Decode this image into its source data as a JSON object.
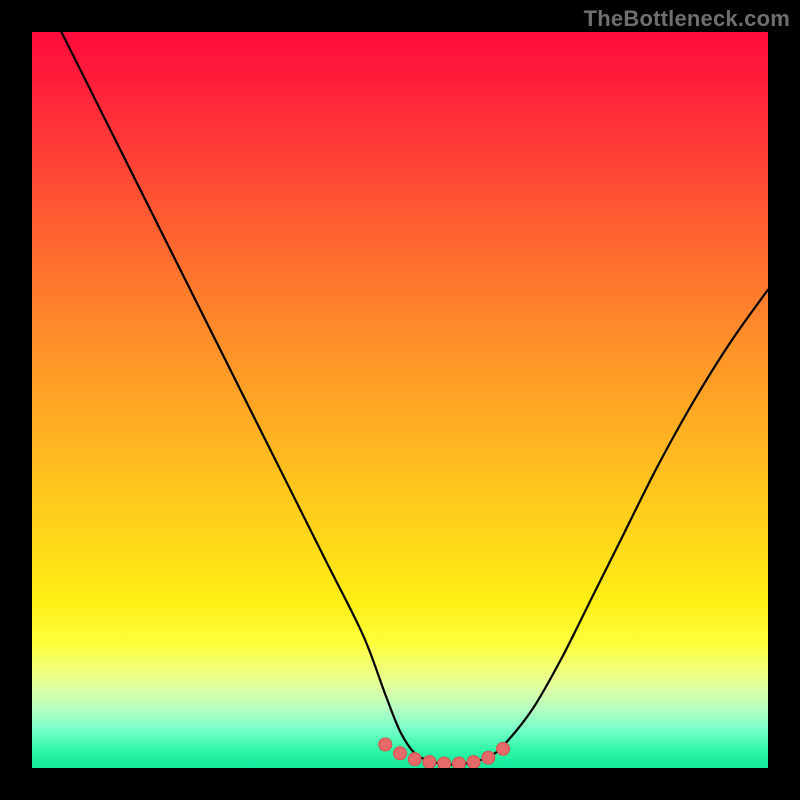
{
  "watermark": "TheBottleneck.com",
  "colors": {
    "frame": "#000000",
    "curve_stroke": "#000000",
    "marker_fill": "#e66a6a",
    "marker_stroke": "#d64e4e",
    "gradient_top": "#ff0a3c",
    "gradient_bottom": "#13e89a"
  },
  "chart_data": {
    "type": "line",
    "title": "",
    "xlabel": "",
    "ylabel": "",
    "xlim": [
      0,
      100
    ],
    "ylim": [
      0,
      100
    ],
    "grid": false,
    "series": [
      {
        "name": "bottleneck-curve",
        "x": [
          4,
          10,
          15,
          20,
          25,
          30,
          35,
          40,
          45,
          48,
          50,
          52,
          54,
          56,
          58,
          60,
          62,
          64,
          68,
          72,
          76,
          80,
          85,
          90,
          95,
          100
        ],
        "values": [
          100,
          88,
          78,
          68,
          58,
          48,
          38,
          28,
          18,
          10,
          5,
          2,
          1,
          0.5,
          0.5,
          0.8,
          1.5,
          3,
          8,
          15,
          23,
          31,
          41,
          50,
          58,
          65
        ]
      }
    ],
    "markers": {
      "name": "optimal-range",
      "x": [
        48,
        50,
        52,
        54,
        56,
        58,
        60,
        62,
        64
      ],
      "values": [
        3.2,
        2.0,
        1.2,
        0.8,
        0.6,
        0.6,
        0.8,
        1.4,
        2.6
      ]
    }
  }
}
